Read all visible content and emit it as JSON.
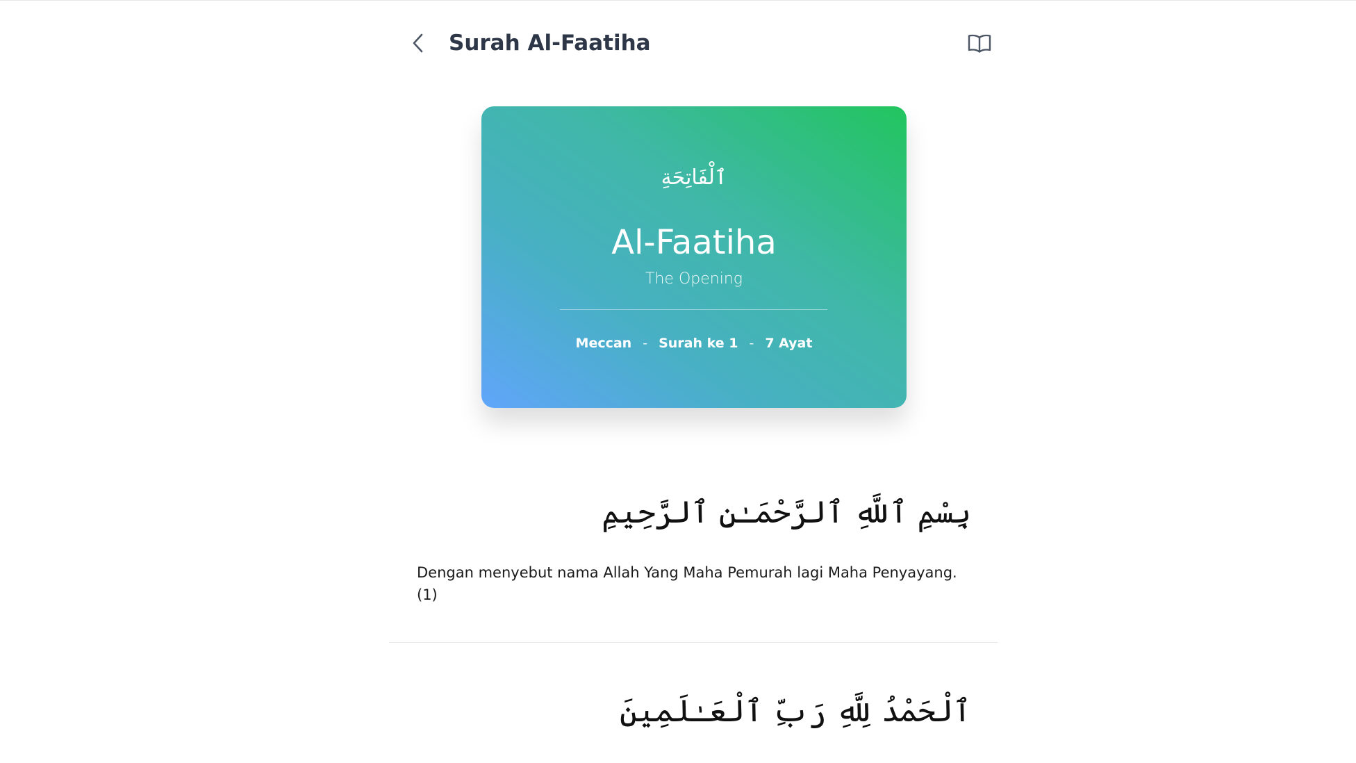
{
  "header": {
    "title": "Surah Al-Faatiha",
    "back_icon": "chevron-left-icon",
    "book_icon": "open-book-icon"
  },
  "card": {
    "arabic_name": "ٱلْفَاتِحَةِ",
    "latin_name": "Al-Faatiha",
    "translation": "The Opening",
    "place": "Meccan",
    "separator": "-",
    "surah_number": "Surah ke 1",
    "ayat_count": "7 Ayat",
    "gradient_from": "#60a5fa",
    "gradient_to": "#22c55e"
  },
  "ayahs": [
    {
      "arabic": "بِسْمِ ٱللَّهِ ٱلرَّحْمَـٰنِ ٱلرَّحِيمِ",
      "translation": "Dengan menyebut nama Allah Yang Maha Pemurah lagi Maha Penyayang. (1)"
    },
    {
      "arabic": "ٱلْحَمْدُ لِلَّهِ رَبِّ ٱلْعَـٰلَمِينَ",
      "translation": ""
    }
  ]
}
